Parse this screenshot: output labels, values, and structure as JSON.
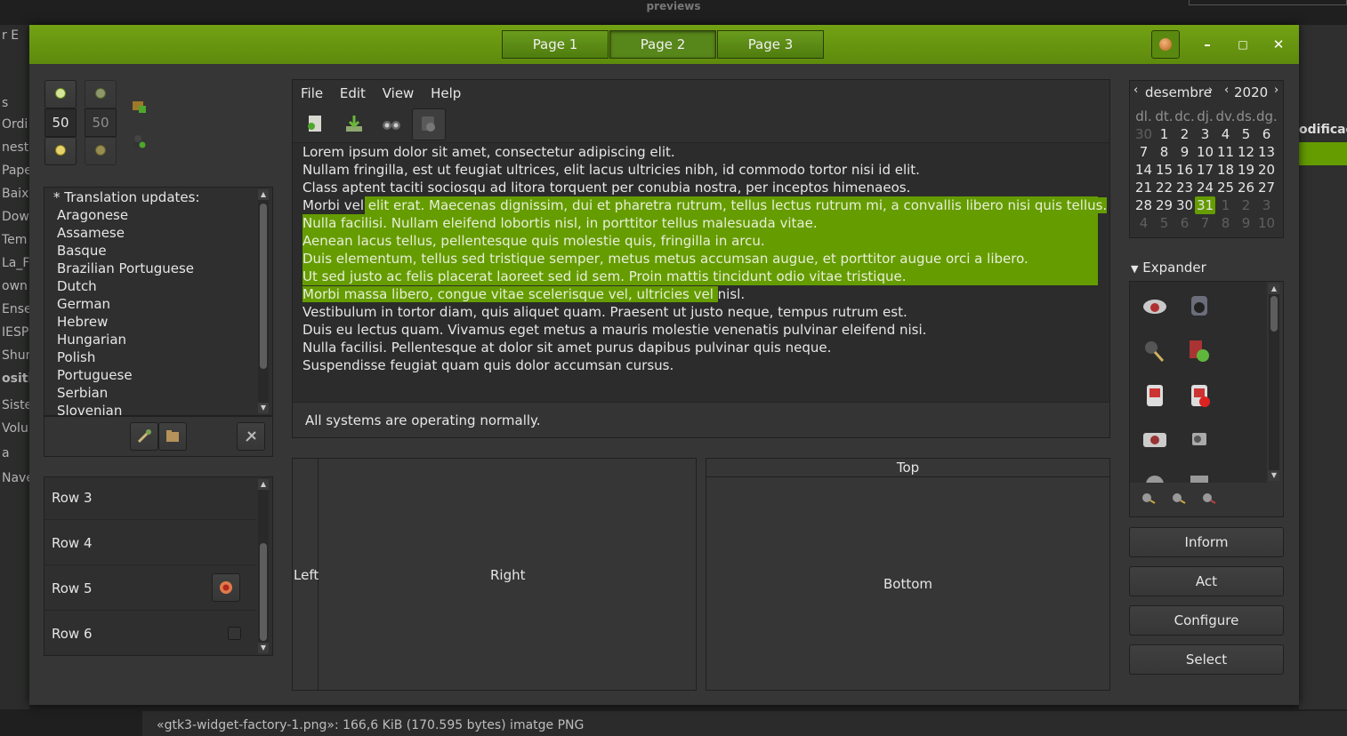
{
  "background": {
    "title": "previews",
    "left_items": [
      "r  E",
      "s",
      "Ordi",
      "neste",
      "Pape",
      "Baix",
      "Dow",
      "Tem",
      "La_F",
      "own",
      "Ense",
      "IESP",
      "Shur",
      "ositi",
      "Siste",
      "Volu",
      "a",
      "Nave"
    ],
    "right_text": "odificac",
    "status_text": "«gtk3-widget-factory-1.png»: 166,6 KiB (170.595 bytes) imatge PNG"
  },
  "headerbar": {
    "tabs": [
      "Page 1",
      "Page 2",
      "Page 3"
    ],
    "active_tab": 1,
    "minimize": "–",
    "maximize": "□",
    "close": "✕"
  },
  "spinners": {
    "value1": "50",
    "value2": "50"
  },
  "translations": {
    "header": "* Translation updates:",
    "items": [
      "Aragonese",
      "Assamese",
      "Basque",
      "Brazilian Portuguese",
      "Dutch",
      "German",
      "Hebrew",
      "Hungarian",
      "Polish",
      "Portuguese",
      "Serbian",
      "Slovenian"
    ]
  },
  "rows": [
    "Row 3",
    "Row 4",
    "Row 5",
    "Row 6"
  ],
  "menu": [
    "File",
    "Edit",
    "View",
    "Help"
  ],
  "text_lines": [
    {
      "pre": "Lorem ipsum dolor sit amet, consectetur adipiscing elit.",
      "sel": "",
      "post": ""
    },
    {
      "pre": "Nullam fringilla, est ut feugiat ultrices, elit lacus ultricies nibh, id commodo tortor nisi id elit.",
      "sel": "",
      "post": ""
    },
    {
      "pre": "Class aptent taciti sociosqu ad litora torquent per conubia nostra, per inceptos himenaeos.",
      "sel": "",
      "post": ""
    },
    {
      "pre": "Morbi vel ",
      "sel": "elit erat. Maecenas dignissim, dui et pharetra rutrum, tellus lectus rutrum mi, a convallis libero nisi quis tellus.",
      "post": ""
    },
    {
      "pre": "",
      "sel": "Nulla facilisi. Nullam eleifend lobortis nisl, in porttitor tellus malesuada vitae.",
      "post": ""
    },
    {
      "pre": "",
      "sel": "Aenean lacus tellus, pellentesque quis molestie quis, fringilla in arcu.",
      "post": ""
    },
    {
      "pre": "",
      "sel": "Duis elementum, tellus sed tristique semper, metus metus accumsan augue, et porttitor augue orci a libero.",
      "post": ""
    },
    {
      "pre": "",
      "sel": "Ut sed justo ac felis placerat laoreet sed id sem. Proin mattis tincidunt odio vitae tristique.",
      "post": ""
    },
    {
      "pre": "",
      "sel": "Morbi massa libero, congue vitae scelerisque vel, ultricies vel ",
      "post": "nisl."
    },
    {
      "pre": "Vestibulum in tortor diam, quis aliquet quam. Praesent ut justo neque, tempus rutrum est.",
      "sel": "",
      "post": ""
    },
    {
      "pre": "Duis eu lectus quam. Vivamus eget metus a mauris molestie venenatis pulvinar eleifend nisi.",
      "sel": "",
      "post": ""
    },
    {
      "pre": "Nulla facilisi. Pellentesque at dolor sit amet purus dapibus pulvinar quis neque.",
      "sel": "",
      "post": ""
    },
    {
      "pre": "Suspendisse feugiat quam quis dolor accumsan cursus.",
      "sel": "",
      "post": ""
    }
  ],
  "status": "All systems are operating normally.",
  "paned": {
    "left": "Left",
    "right": "Right",
    "top": "Top",
    "bottom": "Bottom"
  },
  "calendar": {
    "month": "desembre",
    "year": "2020",
    "weekdays": [
      "dl.",
      "dt.",
      "dc.",
      "dj.",
      "dv.",
      "ds.",
      "dg."
    ],
    "weeks": [
      [
        "30",
        "1",
        "2",
        "3",
        "4",
        "5",
        "6"
      ],
      [
        "7",
        "8",
        "9",
        "10",
        "11",
        "12",
        "13"
      ],
      [
        "14",
        "15",
        "16",
        "17",
        "18",
        "19",
        "20"
      ],
      [
        "21",
        "22",
        "23",
        "24",
        "25",
        "26",
        "27"
      ],
      [
        "28",
        "29",
        "30",
        "31",
        "1",
        "2",
        "3"
      ],
      [
        "4",
        "5",
        "6",
        "7",
        "8",
        "9",
        "10"
      ]
    ],
    "selected": "31"
  },
  "expander": {
    "label": "Expander"
  },
  "side_buttons": [
    "Inform",
    "Act",
    "Configure",
    "Select"
  ]
}
